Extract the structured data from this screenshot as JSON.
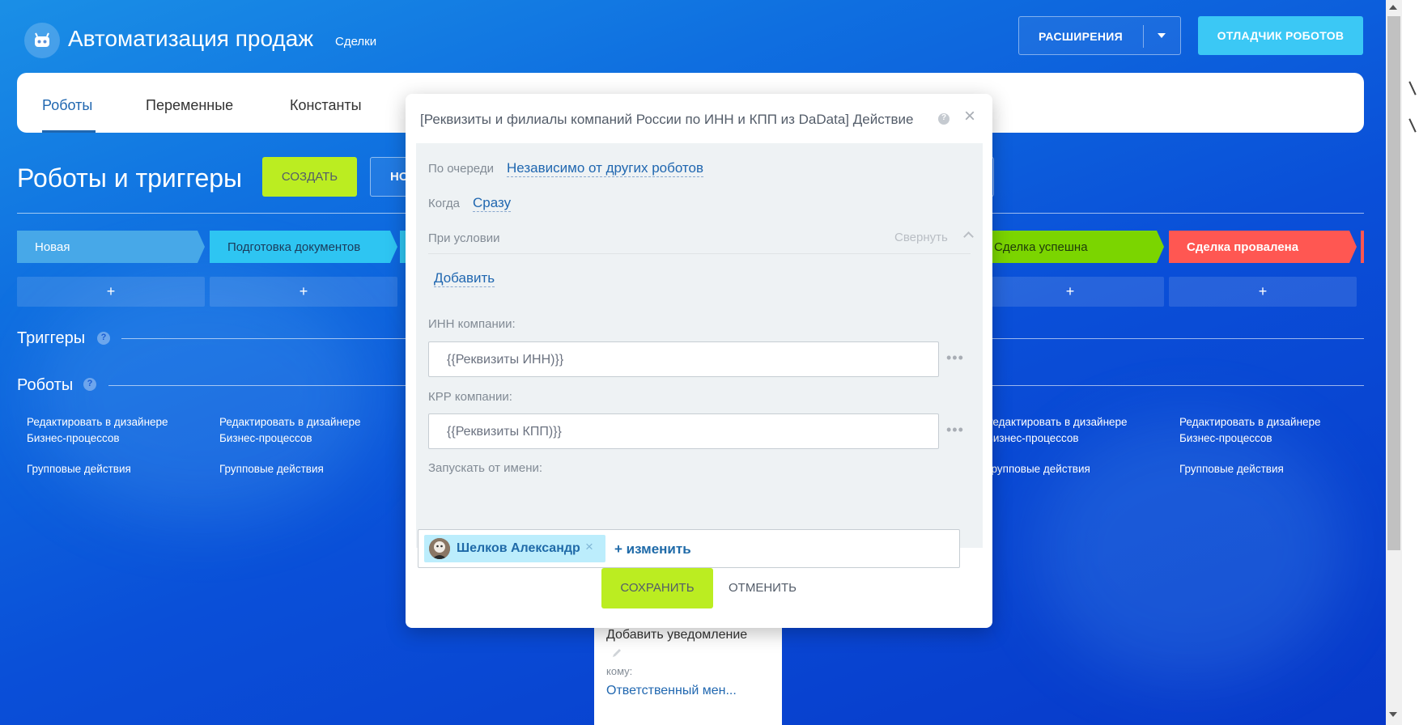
{
  "header": {
    "title": "Автоматизация продаж",
    "subtitle": "Сделки",
    "extensions_label": "РАСШИРЕНИЯ",
    "debugger_label": "ОТЛАДЧИК РОБОТОВ"
  },
  "tabs": [
    {
      "label": "Роботы",
      "active": true
    },
    {
      "label": "Переменные",
      "active": false
    },
    {
      "label": "Константы",
      "active": false
    }
  ],
  "page": {
    "title": "Роботы и триггеры",
    "create_label": "СОЗДАТЬ",
    "ghost_label": "НО",
    "triggers_label": "Триггеры",
    "robots_label": "Роботы",
    "help_glyph": "?"
  },
  "stages": [
    {
      "label": "Новая",
      "color": "#47a8e8"
    },
    {
      "label": "Подготовка документов",
      "color": "#2ec5f2"
    },
    {
      "label": "Сделка успешна",
      "color": "#7bd500"
    },
    {
      "label": "Сделка провалена",
      "color": "#ff5752"
    }
  ],
  "columns": {
    "plus": "+",
    "edit_link": "Редактировать в дизайнере Бизнес-процессов",
    "group_actions": "Групповые действия"
  },
  "notification_card": {
    "title": "Добавить уведомление",
    "to_label": "кому:",
    "to_value": "Ответственный мен..."
  },
  "modal": {
    "title": "[Реквизиты и филиалы компаний России по ИНН и КПП из DaData] Действие",
    "help_glyph": "?",
    "close_glyph": "×",
    "queue_label": "По очереди",
    "queue_value": "Независимо от других роботов",
    "when_label": "Когда",
    "when_value": "Сразу",
    "condition_label": "При условии",
    "collapse_label": "Свернуть",
    "add_label": "Добавить",
    "inn_label": "ИНН компании:",
    "inn_value": "{{Реквизиты ИНН)}}",
    "kpp_label": "КРР компании:",
    "kpp_value": "{{Реквизиты КПП)}}",
    "more_glyph": "•••",
    "run_as_label": "Запускать от имени:",
    "user_name": "Шелков Александр",
    "remove_glyph": "×",
    "change_label": "+ изменить",
    "save_label": "СОХРАНИТЬ",
    "cancel_label": "ОТМЕНИТЬ"
  }
}
